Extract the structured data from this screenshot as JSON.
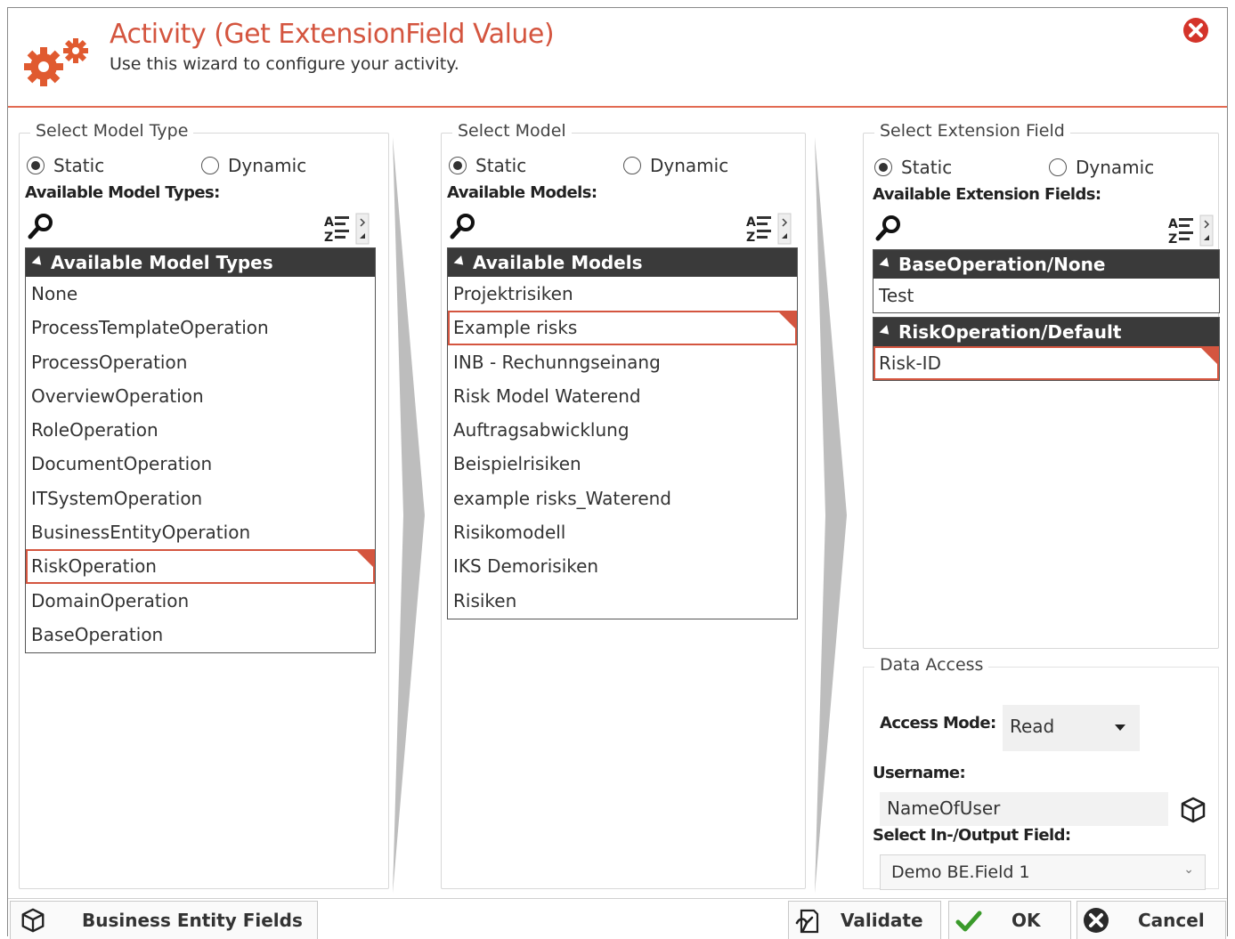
{
  "header": {
    "title": "Activity (Get ExtensionField Value)",
    "subtitle": "Use this wizard to configure your activity."
  },
  "panels": {
    "model_type": {
      "legend": "Select Model Type",
      "static_label": "Static",
      "dynamic_label": "Dynamic",
      "selected_mode": "Static",
      "available_label": "Available Model Types:",
      "group_header": "Available Model Types",
      "items": [
        "None",
        "ProcessTemplateOperation",
        "ProcessOperation",
        "OverviewOperation",
        "RoleOperation",
        "DocumentOperation",
        "ITSystemOperation",
        "BusinessEntityOperation",
        "RiskOperation",
        "DomainOperation",
        "BaseOperation"
      ],
      "selected_item": "RiskOperation"
    },
    "model": {
      "legend": "Select Model",
      "static_label": "Static",
      "dynamic_label": "Dynamic",
      "selected_mode": "Static",
      "available_label": "Available Models:",
      "group_header": "Available Models",
      "items": [
        "Projektrisiken",
        "Example risks",
        "INB - Rechunngseinang",
        "Risk Model Waterend",
        "Auftragsabwicklung",
        "Beispielrisiken",
        "example risks_Waterend",
        "Risikomodell",
        "IKS Demorisiken",
        "Risiken"
      ],
      "selected_item": "Example risks"
    },
    "extension_field": {
      "legend": "Select Extension Field",
      "static_label": "Static",
      "dynamic_label": "Dynamic",
      "selected_mode": "Static",
      "available_label": "Available Extension Fields:",
      "groups": [
        {
          "header": "BaseOperation/None",
          "items": [
            "Test"
          ]
        },
        {
          "header": "RiskOperation/Default",
          "items": [
            "Risk-ID"
          ]
        }
      ],
      "selected_item": "Risk-ID"
    }
  },
  "data_access": {
    "legend": "Data Access",
    "access_mode_label": "Access Mode:",
    "access_mode_value": "Read",
    "username_label": "Username:",
    "username_value": "NameOfUser",
    "io_field_label": "Select In-/Output Field:",
    "io_field_value": "Demo BE.Field 1"
  },
  "footer": {
    "business_entity_label": "Business Entity Fields",
    "validate_label": "Validate",
    "ok_label": "OK",
    "cancel_label": "Cancel"
  },
  "colors": {
    "accent": "#d4553f",
    "header_bar": "#3a3a3a",
    "ok_green": "#3a9a2a"
  }
}
